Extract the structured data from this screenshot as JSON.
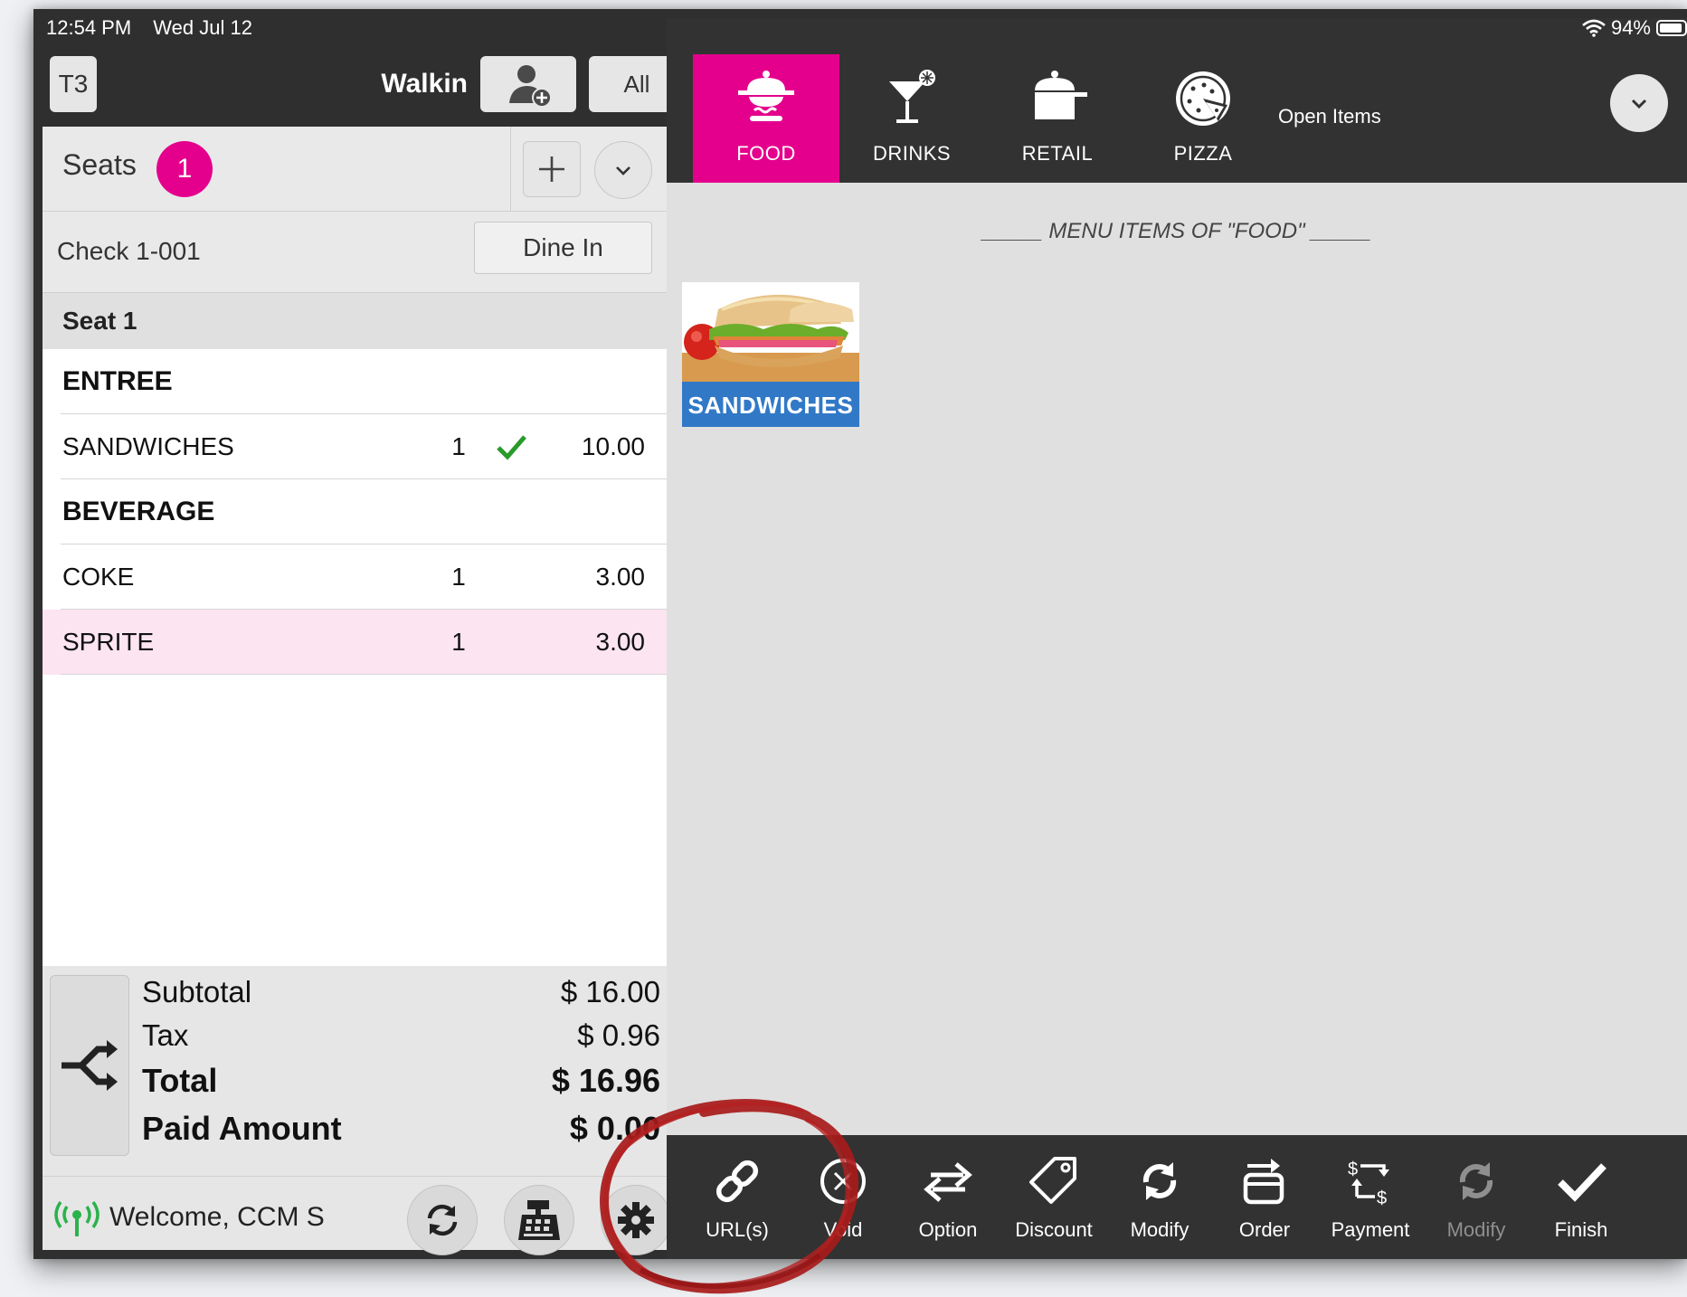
{
  "status_bar": {
    "time": "12:54 PM",
    "date": "Wed Jul 12",
    "battery": "94%"
  },
  "order_header": {
    "table": "T3",
    "customer": "Walkin",
    "filter_label": "All"
  },
  "seats": {
    "label": "Seats",
    "count": "1"
  },
  "check": {
    "label": "Check  1-001",
    "service_type": "Dine In"
  },
  "seat_header": "Seat 1",
  "order_lines": [
    {
      "type": "category",
      "label": "ENTREE"
    },
    {
      "type": "item",
      "name": "SANDWICHES",
      "qty": "1",
      "sent": true,
      "price": "10.00"
    },
    {
      "type": "category",
      "label": "BEVERAGE"
    },
    {
      "type": "item",
      "name": "COKE",
      "qty": "1",
      "sent": false,
      "price": "3.00"
    },
    {
      "type": "item",
      "name": "SPRITE",
      "qty": "1",
      "sent": false,
      "price": "3.00",
      "selected": true
    }
  ],
  "totals": {
    "subtotal_label": "Subtotal",
    "subtotal": "$ 16.00",
    "tax_label": "Tax",
    "tax": "$ 0.96",
    "total_label": "Total",
    "total": "$ 16.96",
    "paid_label": "Paid Amount",
    "paid": "$ 0.00"
  },
  "footer": {
    "welcome": "Welcome, CCM S"
  },
  "categories": [
    {
      "label": "FOOD",
      "icon": "food-tray-icon",
      "active": true
    },
    {
      "label": "DRINKS",
      "icon": "cocktail-icon",
      "active": false
    },
    {
      "label": "RETAIL",
      "icon": "cooking-pot-icon",
      "active": false
    },
    {
      "label": "PIZZA",
      "icon": "pizza-icon",
      "active": false
    }
  ],
  "open_items_label": "Open Items",
  "menu": {
    "title": "_____ MENU ITEMS OF \"FOOD\" _____",
    "items": [
      {
        "label": "SANDWICHES"
      }
    ]
  },
  "actions": [
    {
      "label": "URL(s)",
      "icon": "link-icon",
      "enabled": true
    },
    {
      "label": "Void",
      "icon": "void-x-icon",
      "enabled": true
    },
    {
      "label": "Option",
      "icon": "swap-arrows-icon",
      "enabled": true
    },
    {
      "label": "Discount",
      "icon": "price-tag-icon",
      "enabled": true
    },
    {
      "label": "Modify",
      "icon": "refresh-icon",
      "enabled": true
    },
    {
      "label": "Order",
      "icon": "order-icon",
      "enabled": true
    },
    {
      "label": "Payment",
      "icon": "payment-exchange-icon",
      "enabled": true
    },
    {
      "label": "Modify",
      "icon": "refresh-icon",
      "enabled": false
    },
    {
      "label": "Finish",
      "icon": "checkmark-icon",
      "enabled": true
    }
  ],
  "colors": {
    "accent": "#e4008c",
    "dark_bar": "#323232",
    "tile_blue": "#3179c7",
    "annotation_red": "#a81a1a",
    "signal_green": "#2bb24c"
  }
}
